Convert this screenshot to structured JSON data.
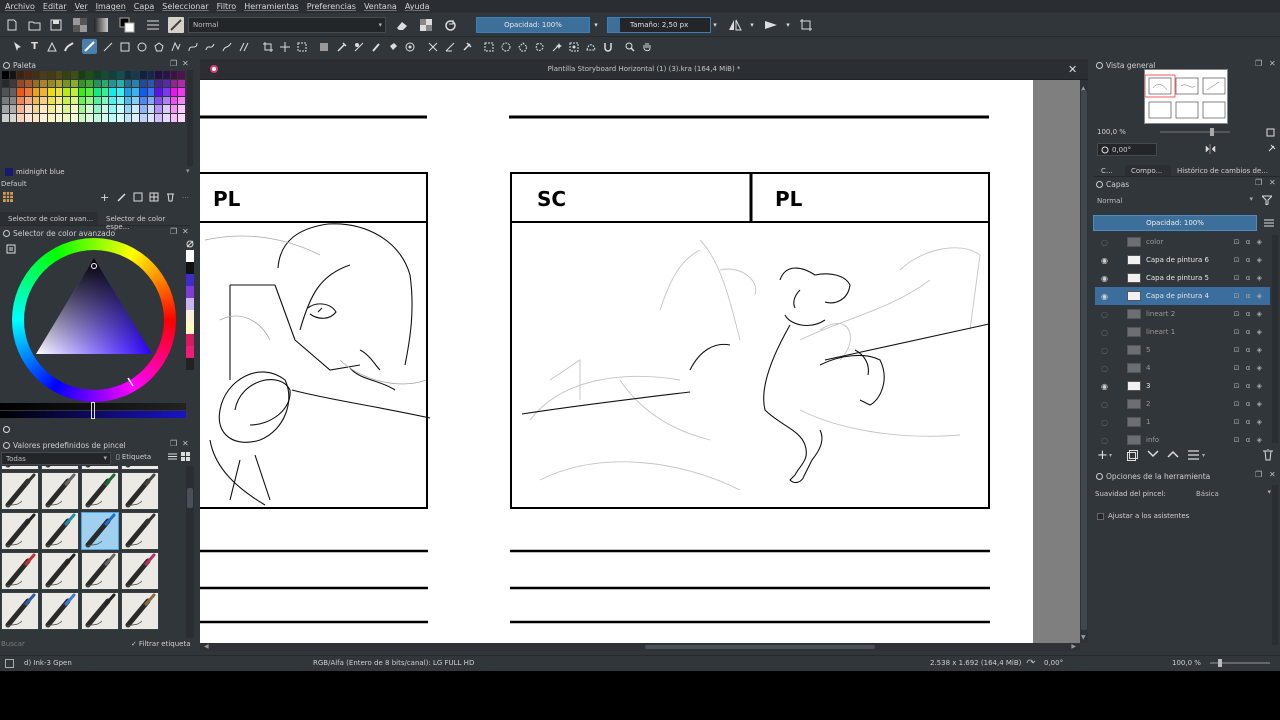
{
  "menu": [
    "Archivo",
    "Editar",
    "Ver",
    "Imagen",
    "Capa",
    "Seleccionar",
    "Filtro",
    "Herramientas",
    "Preferencias",
    "Ventana",
    "Ayuda"
  ],
  "toolbar": {
    "blend_mode": "Normal",
    "opacity_label": "Opacidad: 100%",
    "opacity_value": 1.0,
    "size_label": "Tamaño: 2,50 px"
  },
  "palette": {
    "title": "Paleta",
    "current_color": "midnight blue",
    "set_name": "Default"
  },
  "color_tabs": [
    "Selector de color avan...",
    "Selector de color espe..."
  ],
  "color_selector": {
    "title": "Selector de color avanzado"
  },
  "brush_presets": {
    "title": "Valores predefinidos de pincel",
    "filter": "Todas",
    "tag_label": "Etiqueta",
    "search_placeholder": "Buscar",
    "filter_tag_label": "Filtrar etiqueta"
  },
  "document": {
    "title": "Plantilla Storyboard Horizontal (1) (3).kra (164,4 MiB) *",
    "panels": [
      {
        "label": "PL"
      },
      {
        "label_left": "SC",
        "label_right": "PL"
      }
    ]
  },
  "overview": {
    "title": "Vista general",
    "zoom": "100,0 %",
    "rotation": "0,00°"
  },
  "docker_tabs": [
    "C...",
    "Compo...",
    "Histórico de cambios de..."
  ],
  "layers": {
    "title": "Capas",
    "blend_mode": "Normal",
    "opacity_label": "Opacidad: 100%",
    "items": [
      {
        "name": "color",
        "visible": false
      },
      {
        "name": "Capa de pintura 6",
        "visible": true
      },
      {
        "name": "Capa de pintura 5",
        "visible": true
      },
      {
        "name": "Capa de pintura 4",
        "visible": true,
        "active": true
      },
      {
        "name": "lineart 2",
        "visible": false
      },
      {
        "name": "lineart 1",
        "visible": false
      },
      {
        "name": "5",
        "visible": false
      },
      {
        "name": "4",
        "visible": false
      },
      {
        "name": "3",
        "visible": true
      },
      {
        "name": "2",
        "visible": false
      },
      {
        "name": "1",
        "visible": false
      },
      {
        "name": "info",
        "visible": false
      }
    ]
  },
  "tool_options": {
    "title": "Opciones de la herramienta",
    "smoothing_label": "Suavidad del pincel:",
    "smoothing_value": "Básica",
    "assistants_label": "Ajustar a los asistentes"
  },
  "status": {
    "brush_name": "d) Ink-3 Gpen",
    "color_info": "RGB/Alfa (Entero de 8 bits/canal): LG FULL HD",
    "dimensions": "2.538 x 1.692 (164,4 MiB)",
    "rotation": "0,00°",
    "zoom": "100,0 %"
  },
  "colors": {
    "accent": "#3b6d9d",
    "panel_bg": "#31363b",
    "canvas_bg": "#7f7f7f"
  }
}
